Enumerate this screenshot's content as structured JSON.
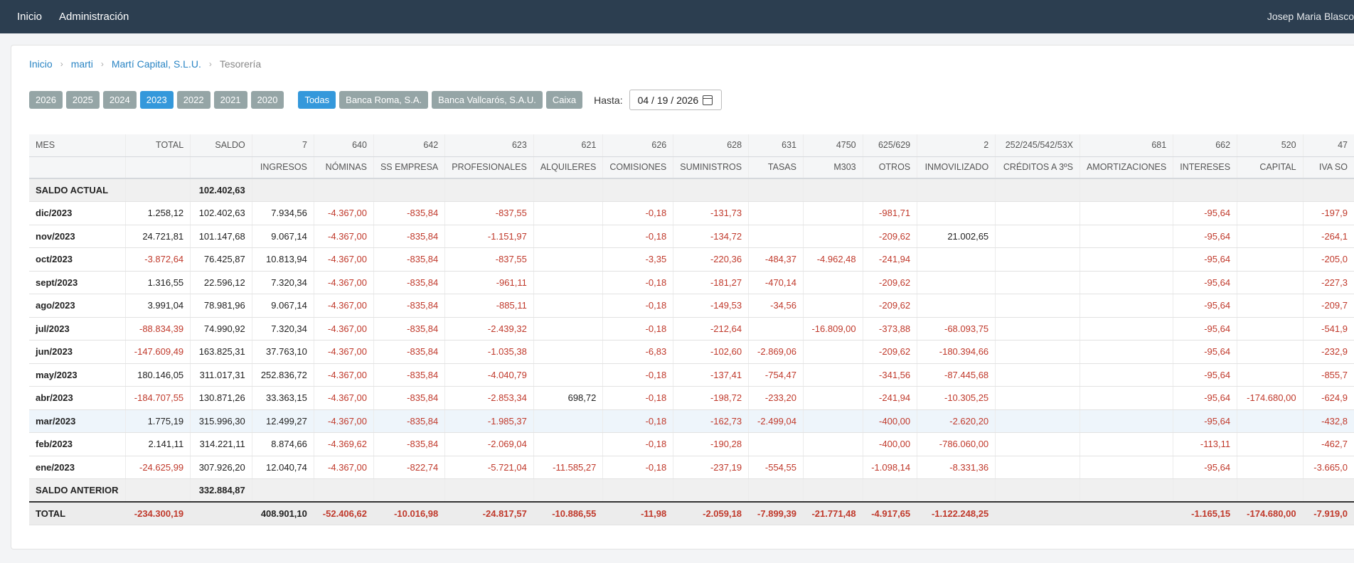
{
  "nav": {
    "home": "Inicio",
    "admin": "Administración",
    "user": "Josep Maria Blasco"
  },
  "breadcrumb": {
    "b0": "Inicio",
    "b1": "marti",
    "b2": "Martí Capital, S.L.U.",
    "b3": "Tesorería"
  },
  "years": [
    "2026",
    "2025",
    "2024",
    "2023",
    "2022",
    "2021",
    "2020"
  ],
  "active_year": "2023",
  "banks": [
    "Todas",
    "Banca Roma, S.A.",
    "Banca Vallcarós, S.A.U.",
    "Caixa"
  ],
  "active_bank": "Todas",
  "hasta": {
    "label": "Hasta:",
    "value": "04 / 19 / 2026"
  },
  "table": {
    "codes": [
      "MES",
      "TOTAL",
      "SALDO",
      "7",
      "640",
      "642",
      "623",
      "621",
      "626",
      "628",
      "631",
      "4750",
      "625/629",
      "2",
      "252/245/542/53X",
      "681",
      "662",
      "520",
      "47"
    ],
    "names": [
      "",
      "",
      "",
      "INGRESOS",
      "NÓMINAS",
      "SS EMPRESA",
      "PROFESIONALES",
      "ALQUILERES",
      "COMISIONES",
      "SUMINISTROS",
      "TASAS",
      "M303",
      "OTROS",
      "INMOVILIZADO",
      "CRÉDITOS A 3ºS",
      "AMORTIZACIONES",
      "INTERESES",
      "CAPITAL",
      "IVA SO"
    ],
    "saldo_actual": {
      "label": "SALDO ACTUAL",
      "value": "102.402,63"
    },
    "rows": [
      [
        "dic/2023",
        "1.258,12",
        "102.402,63",
        "7.934,56",
        "-4.367,00",
        "-835,84",
        "-837,55",
        "",
        "-0,18",
        "-131,73",
        "",
        "",
        "-981,71",
        "",
        "",
        "",
        "-95,64",
        "",
        "-197,9"
      ],
      [
        "nov/2023",
        "24.721,81",
        "101.147,68",
        "9.067,14",
        "-4.367,00",
        "-835,84",
        "-1.151,97",
        "",
        "-0,18",
        "-134,72",
        "",
        "",
        "-209,62",
        "21.002,65",
        "",
        "",
        "-95,64",
        "",
        "-264,1"
      ],
      [
        "oct/2023",
        "-3.872,64",
        "76.425,87",
        "10.813,94",
        "-4.367,00",
        "-835,84",
        "-837,55",
        "",
        "-3,35",
        "-220,36",
        "-484,37",
        "-4.962,48",
        "-241,94",
        "",
        "",
        "",
        "-95,64",
        "",
        "-205,0"
      ],
      [
        "sept/2023",
        "1.316,55",
        "22.596,12",
        "7.320,34",
        "-4.367,00",
        "-835,84",
        "-961,11",
        "",
        "-0,18",
        "-181,27",
        "-470,14",
        "",
        "-209,62",
        "",
        "",
        "",
        "-95,64",
        "",
        "-227,3"
      ],
      [
        "ago/2023",
        "3.991,04",
        "78.981,96",
        "9.067,14",
        "-4.367,00",
        "-835,84",
        "-885,11",
        "",
        "-0,18",
        "-149,53",
        "-34,56",
        "",
        "-209,62",
        "",
        "",
        "",
        "-95,64",
        "",
        "-209,7"
      ],
      [
        "jul/2023",
        "-88.834,39",
        "74.990,92",
        "7.320,34",
        "-4.367,00",
        "-835,84",
        "-2.439,32",
        "",
        "-0,18",
        "-212,64",
        "",
        "-16.809,00",
        "-373,88",
        "-68.093,75",
        "",
        "",
        "-95,64",
        "",
        "-541,9"
      ],
      [
        "jun/2023",
        "-147.609,49",
        "163.825,31",
        "37.763,10",
        "-4.367,00",
        "-835,84",
        "-1.035,38",
        "",
        "-6,83",
        "-102,60",
        "-2.869,06",
        "",
        "-209,62",
        "-180.394,66",
        "",
        "",
        "-95,64",
        "",
        "-232,9"
      ],
      [
        "may/2023",
        "180.146,05",
        "311.017,31",
        "252.836,72",
        "-4.367,00",
        "-835,84",
        "-4.040,79",
        "",
        "-0,18",
        "-137,41",
        "-754,47",
        "",
        "-341,56",
        "-87.445,68",
        "",
        "",
        "-95,64",
        "",
        "-855,7"
      ],
      [
        "abr/2023",
        "-184.707,55",
        "130.871,26",
        "33.363,15",
        "-4.367,00",
        "-835,84",
        "-2.853,34",
        "698,72",
        "-0,18",
        "-198,72",
        "-233,20",
        "",
        "-241,94",
        "-10.305,25",
        "",
        "",
        "-95,64",
        "-174.680,00",
        "-624,9"
      ],
      [
        "mar/2023",
        "1.775,19",
        "315.996,30",
        "12.499,27",
        "-4.367,00",
        "-835,84",
        "-1.985,37",
        "",
        "-0,18",
        "-162,73",
        "-2.499,04",
        "",
        "-400,00",
        "-2.620,20",
        "",
        "",
        "-95,64",
        "",
        "-432,8"
      ],
      [
        "feb/2023",
        "2.141,11",
        "314.221,11",
        "8.874,66",
        "-4.369,62",
        "-835,84",
        "-2.069,04",
        "",
        "-0,18",
        "-190,28",
        "",
        "",
        "-400,00",
        "-786.060,00",
        "",
        "",
        "-113,11",
        "",
        "-462,7"
      ],
      [
        "ene/2023",
        "-24.625,99",
        "307.926,20",
        "12.040,74",
        "-4.367,00",
        "-822,74",
        "-5.721,04",
        "-11.585,27",
        "-0,18",
        "-237,19",
        "-554,55",
        "",
        "-1.098,14",
        "-8.331,36",
        "",
        "",
        "-95,64",
        "",
        "-3.665,0"
      ]
    ],
    "saldo_anterior": {
      "label": "SALDO ANTERIOR",
      "value": "332.884,87"
    },
    "total": [
      "TOTAL",
      "-234.300,19",
      "",
      "408.901,10",
      "-52.406,62",
      "-10.016,98",
      "-24.817,57",
      "-10.886,55",
      "-11,98",
      "-2.059,18",
      "-7.899,39",
      "-21.771,48",
      "-4.917,65",
      "-1.122.248,25",
      "",
      "",
      "-1.165,15",
      "-174.680,00",
      "-7.919,0"
    ]
  },
  "colors": {
    "nav_bg": "#2c3e50",
    "accent": "#3498db",
    "pill_gray": "#95a5a6",
    "negative": "#c0392b",
    "link": "#2a85c4"
  }
}
